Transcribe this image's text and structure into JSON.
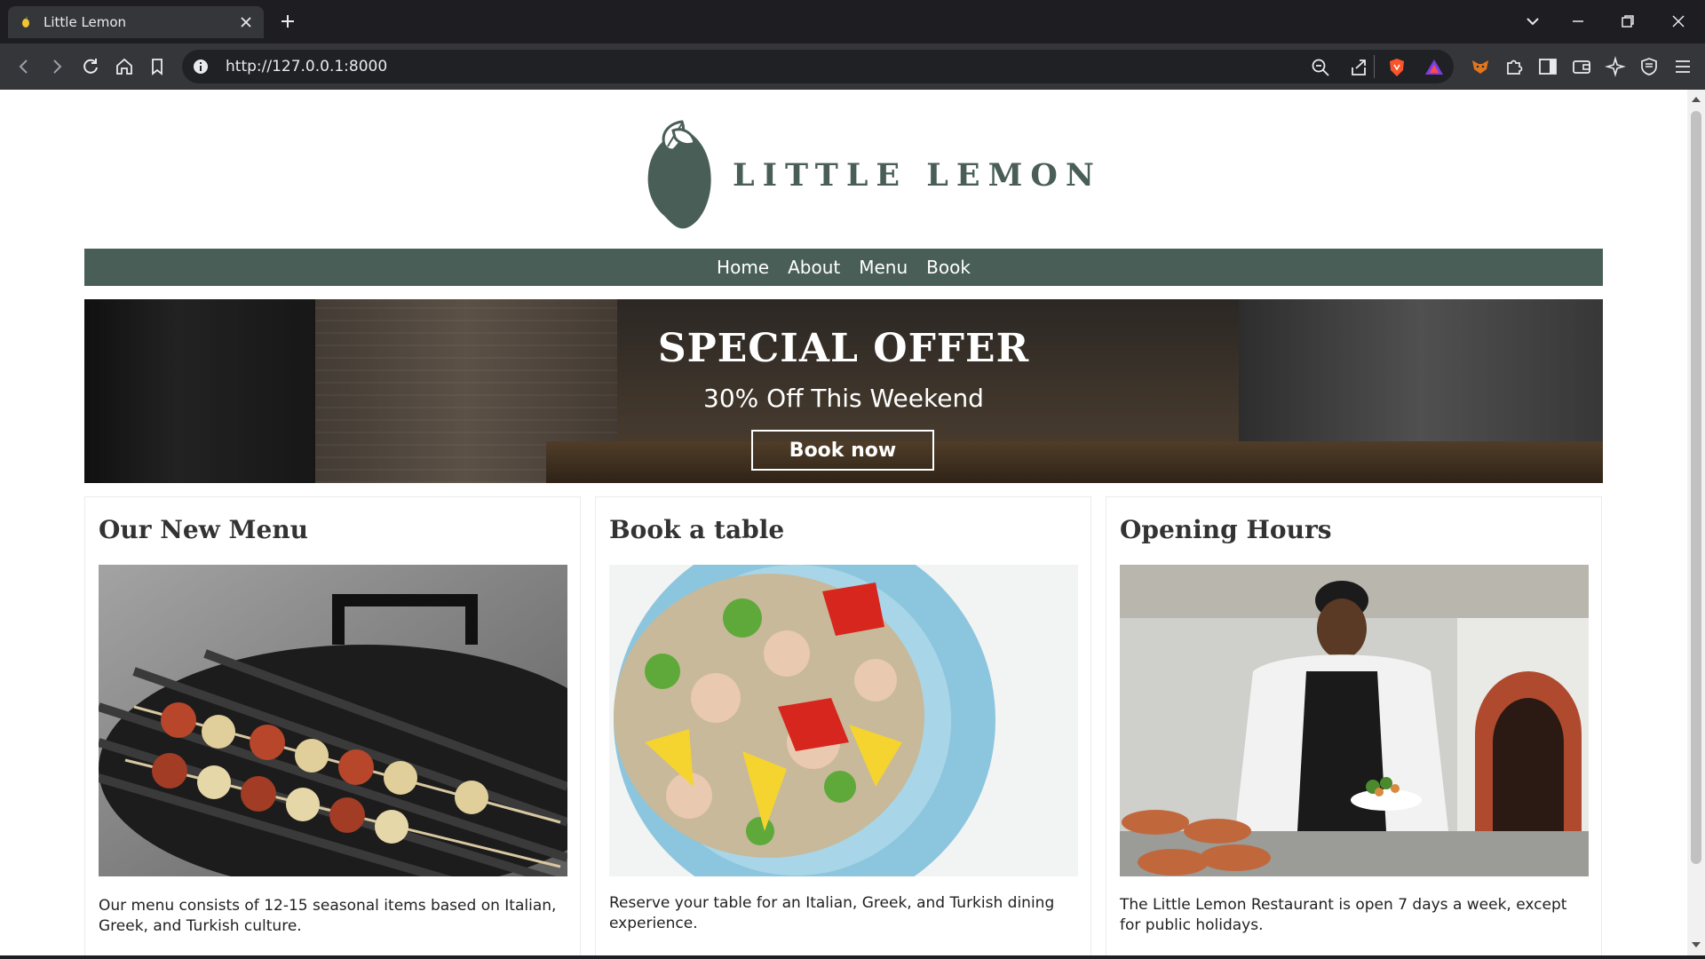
{
  "browser": {
    "tab_title": "Little Lemon",
    "url": "http://127.0.0.1:8000"
  },
  "site": {
    "logo_text": "LITTLE LEMON",
    "nav": [
      "Home",
      "About",
      "Menu",
      "Book"
    ],
    "hero": {
      "title": "SPECIAL OFFER",
      "subtitle": "30% Off This Weekend",
      "button": "Book now"
    },
    "cards": [
      {
        "title": "Our New Menu",
        "text": "Our menu consists of 12-15 seasonal items based on Italian, Greek, and Turkish culture."
      },
      {
        "title": "Book a table",
        "text": "Reserve your table for an Italian, Greek, and Turkish dining experience."
      },
      {
        "title": "Opening Hours",
        "text": "The Little Lemon Restaurant is open 7 days a week, except for public holidays."
      }
    ]
  },
  "colors": {
    "brand_green": "#495e57",
    "chrome_dark": "#1e1e22",
    "chrome_toolbar": "#35363a"
  }
}
